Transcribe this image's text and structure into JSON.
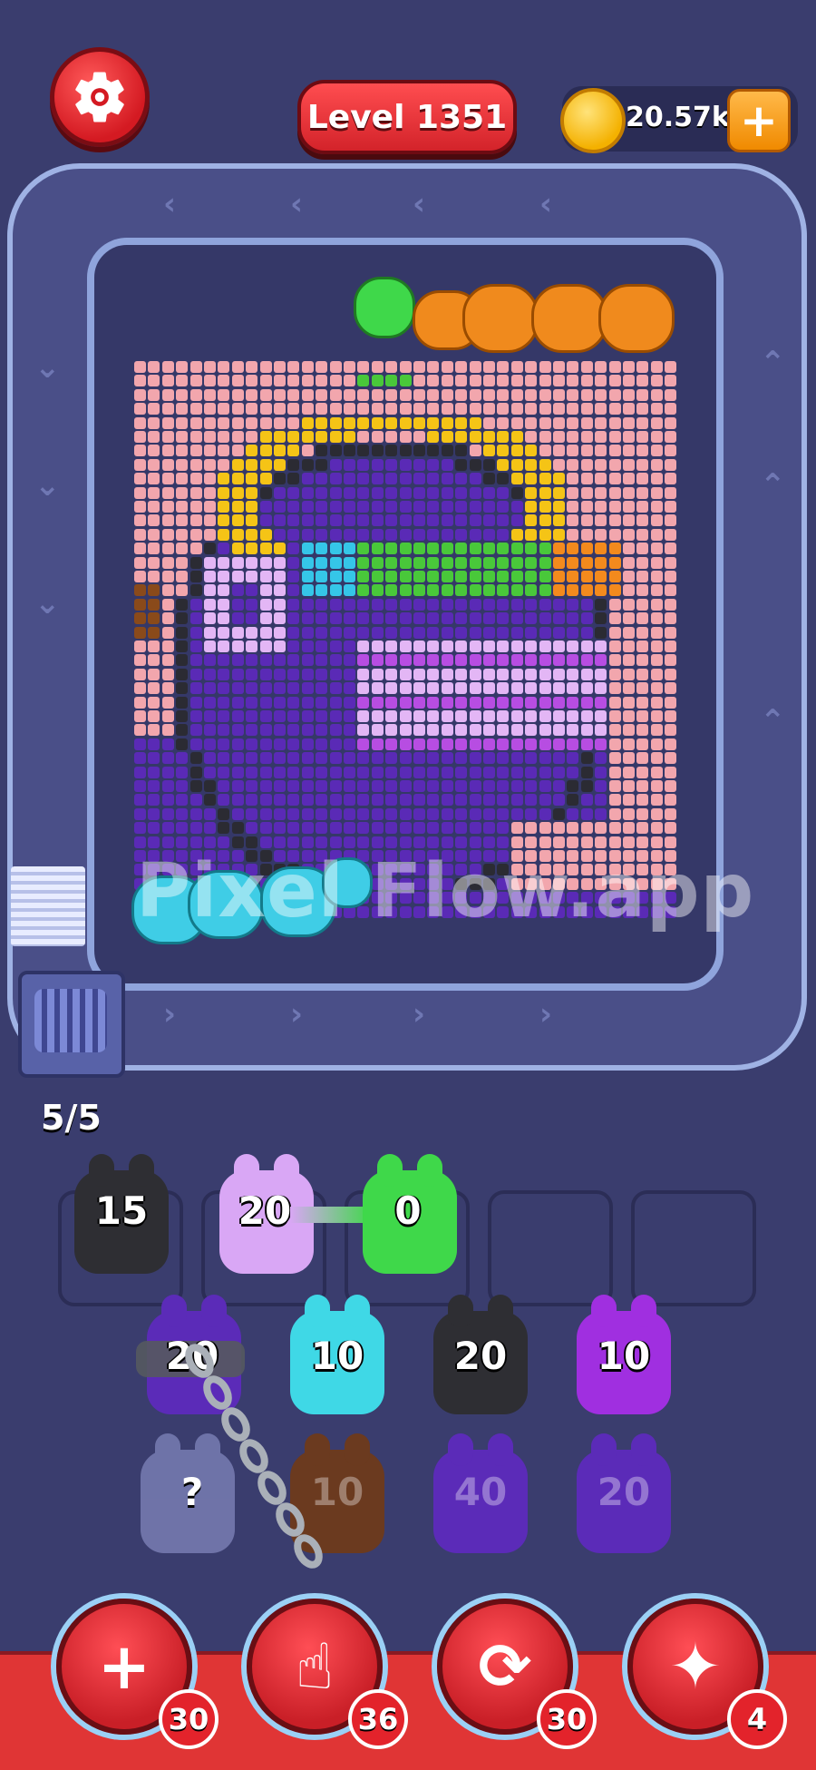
{
  "header": {
    "level_label": "Level 1351",
    "coins": "20.57k",
    "coin_add_symbol": "+"
  },
  "watermark": "Pixel Flow.app",
  "queue_count": "5/5",
  "slots_row": [
    {
      "value": "15",
      "color": "#2e2e33"
    },
    {
      "value": "20",
      "color": "#d9a7f5"
    },
    {
      "value": "0",
      "color": "#3fd84a"
    },
    {
      "value": "",
      "color": ""
    },
    {
      "value": "",
      "color": ""
    }
  ],
  "stacks": [
    {
      "value": "20",
      "color": "#5b2bb8",
      "chained": true
    },
    {
      "value": "10",
      "color": "#3fd8e6"
    },
    {
      "value": "20",
      "color": "#2e2e33"
    },
    {
      "value": "10",
      "color": "#a02fe0"
    }
  ],
  "stacks_row2": [
    {
      "value": "?",
      "color": "#9aa0d8"
    },
    {
      "value": "10",
      "color": "#6b3a1f"
    },
    {
      "value": "40",
      "color": "#5b2bb8"
    },
    {
      "value": "20",
      "color": "#5b2bb8"
    }
  ],
  "tools": [
    {
      "name": "add-slot",
      "count": "30",
      "glyph": "+"
    },
    {
      "name": "hand",
      "count": "36",
      "glyph": "☝"
    },
    {
      "name": "shuffle",
      "count": "30",
      "glyph": "⟳"
    },
    {
      "name": "vacuum",
      "count": "4",
      "glyph": "✦"
    }
  ],
  "colors": {
    "pink": "#f2a6ad",
    "purple": "#5a2ab6",
    "dark": "#2b2b33",
    "yellow": "#f5c416",
    "lilac": "#e3b6f5",
    "magenta": "#b74de2",
    "green": "#49c83a",
    "cyan": "#35c6e8",
    "orange": "#f38a1d",
    "brown": "#8a4a1a"
  }
}
